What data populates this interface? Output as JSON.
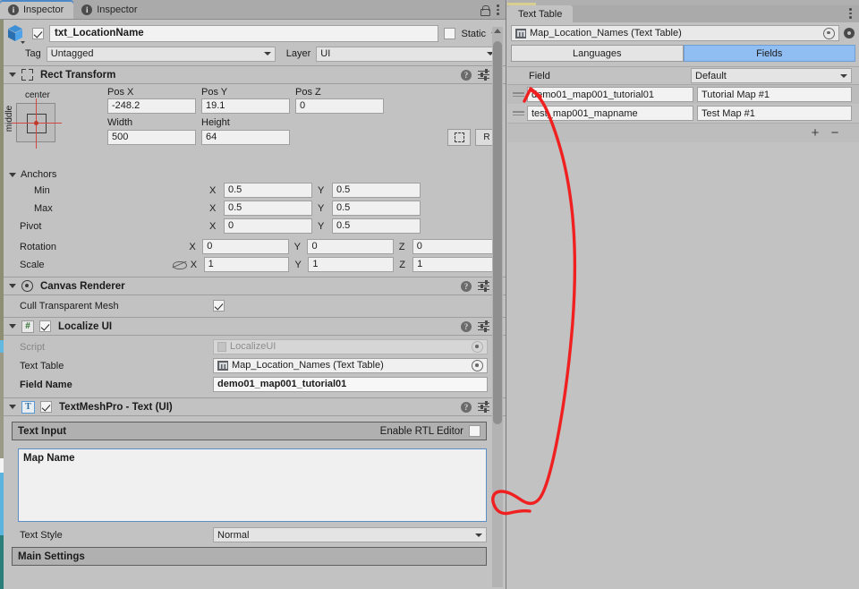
{
  "inspector": {
    "tabs": [
      {
        "label": "Inspector",
        "icon": "info-icon",
        "active": true
      },
      {
        "label": "Inspector",
        "icon": "info-icon",
        "active": false
      }
    ],
    "lock_icon": "lock-icon",
    "kebab_icon": "kebab-menu-icon",
    "object": {
      "enabled": true,
      "name": "txt_LocationName",
      "static_label": "Static",
      "static_checked": false,
      "tag_label": "Tag",
      "tag_value": "Untagged",
      "layer_label": "Layer",
      "layer_value": "UI"
    },
    "rect_transform": {
      "title": "Rect Transform",
      "anchor_preset": {
        "horizontal": "center",
        "vertical": "middle"
      },
      "pos_x_label": "Pos X",
      "pos_x": "-248.2",
      "pos_y_label": "Pos Y",
      "pos_y": "19.1",
      "pos_z_label": "Pos Z",
      "pos_z": "0",
      "width_label": "Width",
      "width": "500",
      "height_label": "Height",
      "height": "64",
      "blueprint_button": "blueprint-mode-icon",
      "raw_button": "R",
      "anchors_label": "Anchors",
      "min_label": "Min",
      "min_x": "0.5",
      "min_y": "0.5",
      "max_label": "Max",
      "max_x": "0.5",
      "max_y": "0.5",
      "pivot_label": "Pivot",
      "pivot_x": "0",
      "pivot_y": "0.5",
      "rotation_label": "Rotation",
      "rot_x": "0",
      "rot_y": "0",
      "rot_z": "0",
      "scale_label": "Scale",
      "scale_x": "1",
      "scale_y": "1",
      "scale_z": "1",
      "axis_x": "X",
      "axis_y": "Y",
      "axis_z": "Z"
    },
    "canvas_renderer": {
      "title": "Canvas Renderer",
      "cull_label": "Cull Transparent Mesh",
      "cull_checked": true
    },
    "localize_ui": {
      "title": "Localize UI",
      "enabled": true,
      "script_label": "Script",
      "script_value": "LocalizeUI",
      "text_table_label": "Text Table",
      "text_table_value": "Map_Location_Names (Text Table)",
      "field_name_label": "Field Name",
      "field_name_value": "demo01_map001_tutorial01"
    },
    "tmp_text": {
      "title": "TextMeshPro - Text (UI)",
      "enabled": true,
      "text_input_label": "Text Input",
      "rtl_label": "Enable RTL Editor",
      "rtl_checked": false,
      "text_value": "Map Name",
      "text_style_label": "Text Style",
      "text_style_value": "Normal",
      "main_settings_label": "Main Settings"
    }
  },
  "text_table": {
    "tab_label": "Text Table",
    "kebab_icon": "kebab-menu-icon",
    "asset_value": "Map_Location_Names (Text Table)",
    "asset_icon": "text-table-asset-icon",
    "picker_icon": "object-picker-icon",
    "gear_icon": "gear-icon",
    "segments": [
      {
        "label": "Languages",
        "active": false
      },
      {
        "label": "Fields",
        "active": true
      }
    ],
    "columns": {
      "field": "Field",
      "default": "Default"
    },
    "rows": [
      {
        "key": "demo01_map001_tutorial01",
        "value": "Tutorial Map #1"
      },
      {
        "key": "test_map001_mapname",
        "value": "Test Map #1"
      }
    ],
    "add_button": "+",
    "remove_button": "−"
  },
  "annotation": {
    "color": "#f02020",
    "description": "hand-drawn arrow from Text Input field to first Field row"
  },
  "colors": {
    "panel_bg": "#c2c2c2",
    "field_bg": "#f0f0f0",
    "accent_selected": "#90bdf2",
    "tab_active_underline": "#4b88c8",
    "annotation_red": "#f02020"
  }
}
